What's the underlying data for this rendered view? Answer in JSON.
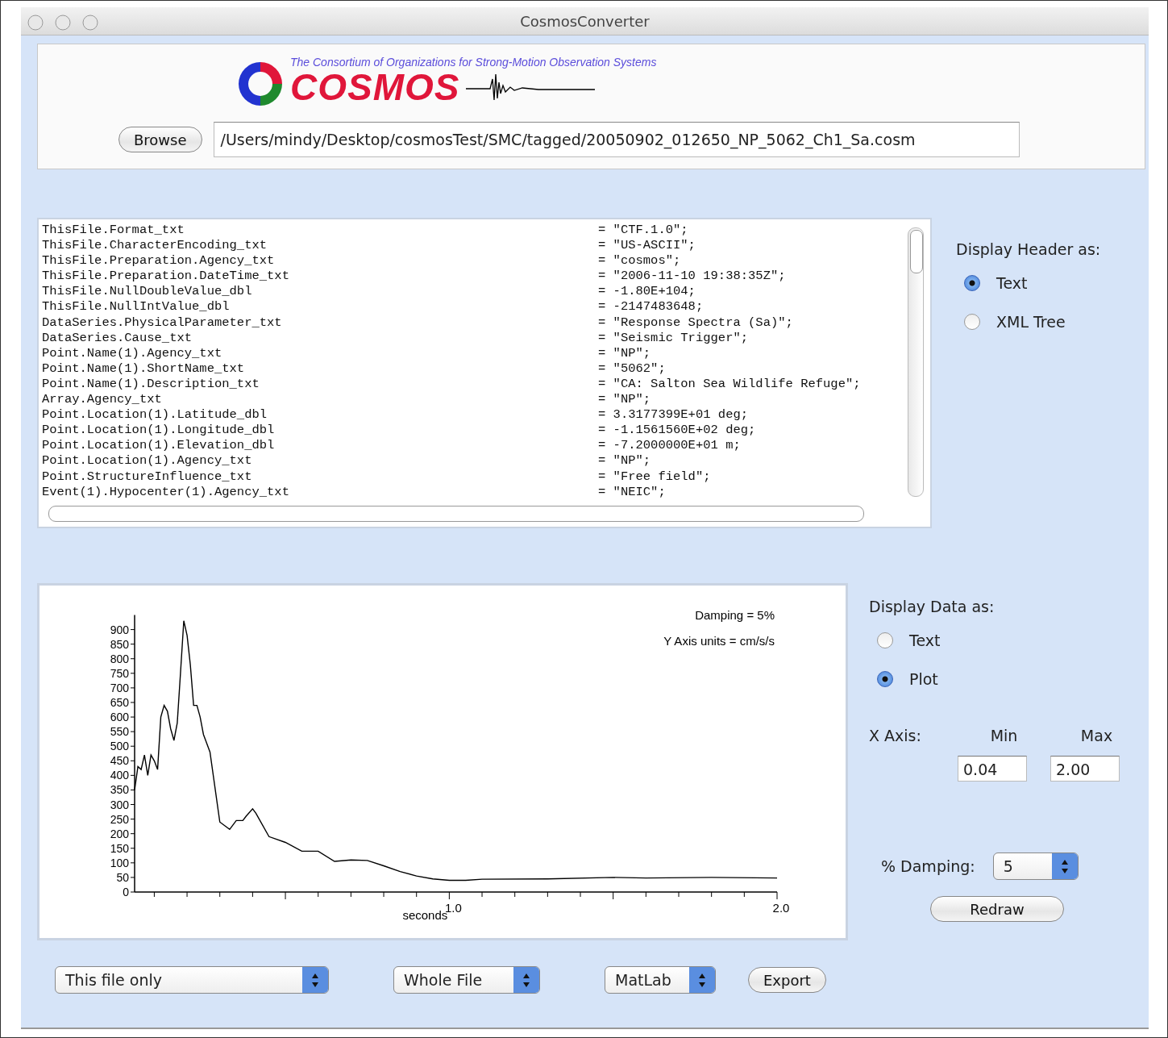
{
  "window": {
    "title": "CosmosConverter"
  },
  "header": {
    "tagline": "The Consortium of Organizations for Strong-Motion Observation Systems",
    "logo_text": "COSMOS",
    "browse_button": "Browse",
    "path": "/Users/mindy/Desktop/cosmosTest/SMC/tagged/20050902_012650_NP_5062_Ch1_Sa.cosm"
  },
  "header_text": [
    {
      "key": "ThisFile.Format_txt",
      "value": "= \"CTF.1.0\";"
    },
    {
      "key": "ThisFile.CharacterEncoding_txt",
      "value": "= \"US-ASCII\";"
    },
    {
      "key": "ThisFile.Preparation.Agency_txt",
      "value": "= \"cosmos\";"
    },
    {
      "key": "ThisFile.Preparation.DateTime_txt",
      "value": "= \"2006-11-10 19:38:35Z\";"
    },
    {
      "key": "ThisFile.NullDoubleValue_dbl",
      "value": "= -1.80E+104;"
    },
    {
      "key": "ThisFile.NullIntValue_dbl",
      "value": "= -2147483648;"
    },
    {
      "key": "DataSeries.PhysicalParameter_txt",
      "value": "= \"Response Spectra (Sa)\";"
    },
    {
      "key": "DataSeries.Cause_txt",
      "value": "= \"Seismic Trigger\";"
    },
    {
      "key": "Point.Name(1).Agency_txt",
      "value": "= \"NP\";"
    },
    {
      "key": "Point.Name(1).ShortName_txt",
      "value": "= \"5062\";"
    },
    {
      "key": "Point.Name(1).Description_txt",
      "value": "= \"CA: Salton Sea Wildlife Refuge\";"
    },
    {
      "key": "Array.Agency_txt",
      "value": "= \"NP\";"
    },
    {
      "key": "Point.Location(1).Latitude_dbl",
      "value": "= 3.3177399E+01 deg;"
    },
    {
      "key": "Point.Location(1).Longitude_dbl",
      "value": "= -1.1561560E+02 deg;"
    },
    {
      "key": "Point.Location(1).Elevation_dbl",
      "value": "= -7.2000000E+01 m;"
    },
    {
      "key": "Point.Location(1).Agency_txt",
      "value": "= \"NP\";"
    },
    {
      "key": "Point.StructureInfluence_txt",
      "value": "= \"Free field\";"
    },
    {
      "key": "Event(1).Hypocenter(1).Agency_txt",
      "value": "= \"NEIC\";"
    }
  ],
  "header_display": {
    "label": "Display Header as:",
    "options": [
      {
        "label": "Text",
        "selected": true
      },
      {
        "label": "XML Tree",
        "selected": false
      }
    ]
  },
  "plot": {
    "chart_data": {
      "type": "line",
      "xlabel": "seconds",
      "xlim": [
        0.04,
        2.0
      ],
      "ylim": [
        0,
        950
      ],
      "xticks": [
        {
          "value": 1.0,
          "label": "1.0"
        },
        {
          "value": 2.0,
          "label": "2.0"
        }
      ],
      "yticks": [
        0,
        50,
        100,
        150,
        200,
        250,
        300,
        350,
        400,
        450,
        500,
        550,
        600,
        650,
        700,
        750,
        800,
        850,
        900
      ],
      "annotations": [
        "Damping = 5%",
        "Y Axis units = cm/s/s"
      ],
      "x": [
        0.04,
        0.05,
        0.06,
        0.07,
        0.08,
        0.09,
        0.1,
        0.11,
        0.12,
        0.13,
        0.14,
        0.15,
        0.16,
        0.17,
        0.18,
        0.19,
        0.2,
        0.21,
        0.22,
        0.23,
        0.24,
        0.25,
        0.27,
        0.3,
        0.33,
        0.35,
        0.37,
        0.38,
        0.4,
        0.41,
        0.45,
        0.5,
        0.55,
        0.6,
        0.65,
        0.7,
        0.75,
        0.8,
        0.85,
        0.9,
        0.95,
        1.0,
        1.05,
        1.1,
        1.3,
        1.5,
        1.6,
        1.8,
        2.0
      ],
      "series": [
        {
          "color": "#000000",
          "values": [
            350,
            430,
            420,
            470,
            400,
            470,
            450,
            420,
            600,
            640,
            620,
            560,
            520,
            580,
            750,
            930,
            880,
            780,
            640,
            640,
            600,
            540,
            480,
            240,
            215,
            245,
            245,
            260,
            285,
            270,
            190,
            170,
            140,
            140,
            105,
            110,
            108,
            90,
            70,
            55,
            45,
            40,
            40,
            44,
            45,
            50,
            48,
            50,
            48
          ]
        }
      ]
    }
  },
  "data_display": {
    "label": "Display Data as:",
    "options": [
      {
        "label": "Text",
        "selected": false
      },
      {
        "label": "Plot",
        "selected": true
      }
    ]
  },
  "x_axis": {
    "label": "X Axis:",
    "min_label": "Min",
    "max_label": "Max",
    "min_value": "0.04",
    "max_value": "2.00"
  },
  "damping": {
    "label": "% Damping:",
    "value": "5"
  },
  "redraw_button": "Redraw",
  "bottom_selects": [
    {
      "value": "This file only"
    },
    {
      "value": "Whole File"
    },
    {
      "value": "MatLab"
    }
  ],
  "export_button": "Export"
}
